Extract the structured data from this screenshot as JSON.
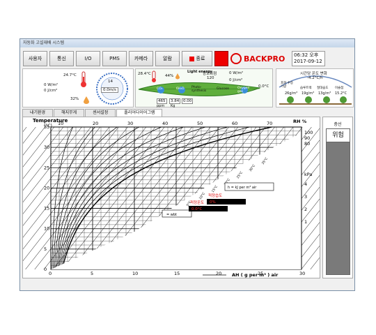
{
  "window": {
    "title": "자동화 고설재배 시스템"
  },
  "toolbar": {
    "buttons": [
      "사용자",
      "통신",
      "I/O",
      "PMS",
      "카메라",
      "알람"
    ],
    "end_label": "종료",
    "logo_text": "BACKPRO",
    "time": "06:32 오후",
    "date": "2017-09-12"
  },
  "panel1": {
    "temp": "24.7°C",
    "rad1": "0 W/m²",
    "rad2": "0 J/cm²",
    "humidity": "32%",
    "compass_value": "14",
    "wind": "0.0m/s"
  },
  "panel2": {
    "temp": "28.4°C",
    "humidity": "44%",
    "light_label": "Light energy",
    "photo_label": "광포화점",
    "photo_value": "120",
    "rad1": "0 W/m²",
    "rad2": "0 J/cm²",
    "water_temp": "0.0°C",
    "co2": "465",
    "co2_unit": "ppm",
    "kg": "3.84",
    "kg_unit": "Kg",
    "val3": "0.00",
    "leaf_labels": [
      "CO₂",
      "6H₂O",
      "Photo-synthesis",
      "Glucose",
      "Oxygen gas"
    ]
  },
  "panel3": {
    "title": "시간당 온도 변화",
    "delta": "-4.2°C/h",
    "items": [
      {
        "label": "포화 수증기량",
        "value": "26g/m³"
      },
      {
        "label": "습루트랙",
        "value": "19g/m³"
      },
      {
        "label": "절대습도",
        "value": "13g/m³"
      },
      {
        "label": "이슬점",
        "value": "15.2°C"
      }
    ]
  },
  "tabs": [
    "내기환경",
    "해지무게",
    "센서설정",
    "폴리어다이어그램"
  ],
  "chart": {
    "ylabel": "Temperature",
    "yunit": "(°C)",
    "rh_label": "RH %",
    "kpa_label": "kPa",
    "xlabel": "AH  ( g per m³ ) air",
    "box_label": "h = kJ per m³ air",
    "box_wbt": "= wbt",
    "label_humidity": "적정습도",
    "value_humidity": "0%",
    "label_temp": "적정온도",
    "value_temp": "0.0°C",
    "temp_ticks": [
      "35",
      "30",
      "25",
      "20",
      "15",
      "10",
      "5",
      "0"
    ],
    "top_ticks": [
      "10",
      "20",
      "30",
      "40",
      "50",
      "60",
      "70"
    ],
    "bottom_ticks": [
      "0",
      "5",
      "10",
      "15",
      "20",
      "25",
      "30"
    ],
    "rh_ticks": [
      "100",
      "90",
      "80"
    ],
    "kpa_ticks": [
      "4",
      "3",
      "2",
      "1"
    ],
    "diag_labels": [
      "35°C",
      "30°C",
      "25°C",
      "20°C",
      "15°C",
      "10°C",
      "5°C"
    ]
  },
  "side": {
    "label": "층선",
    "status": "위험"
  }
}
